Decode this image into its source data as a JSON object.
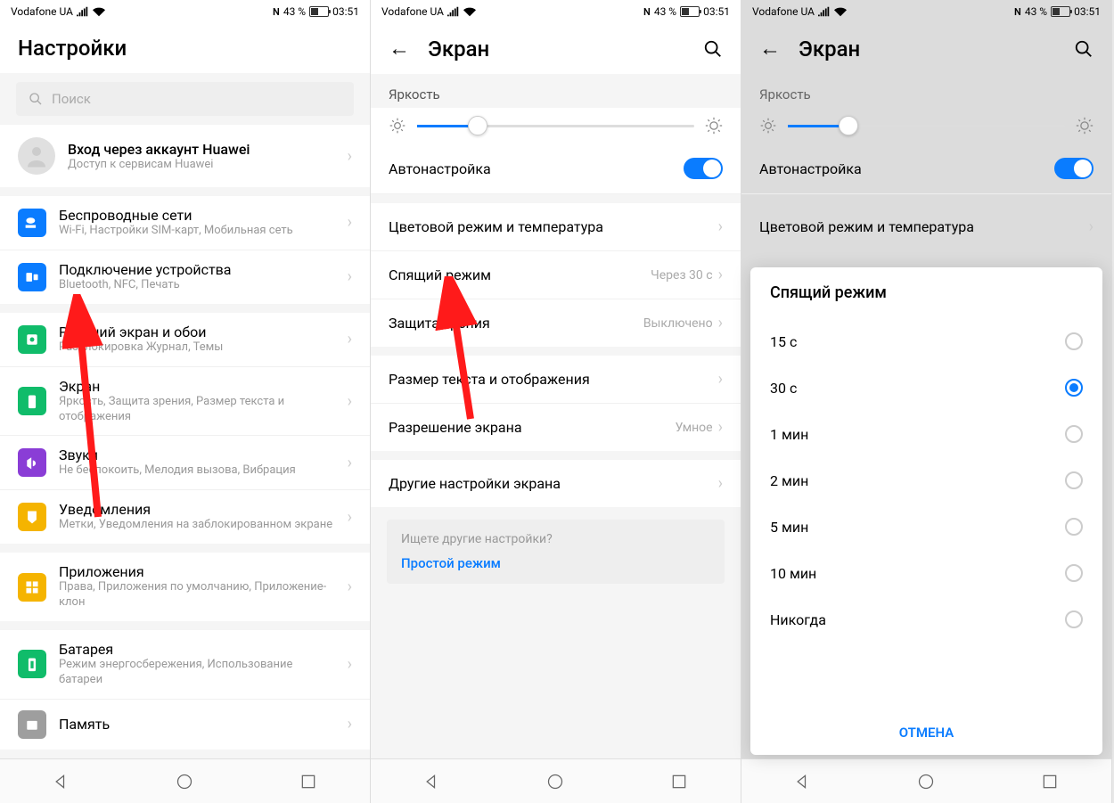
{
  "status": {
    "carrier": "Vodafone UA",
    "battery_pct": "43 %",
    "time": "03:51",
    "nfc": "N"
  },
  "screen1": {
    "title": "Настройки",
    "search_placeholder": "Поиск",
    "account": {
      "title": "Вход через аккаунт Huawei",
      "sub": "Доступ к сервисам Huawei"
    },
    "items": [
      {
        "title": "Беспроводные сети",
        "sub": "Wi-Fi, Настройки SIM-карт, Мобильная сеть",
        "color": "#0a7cff"
      },
      {
        "title": "Подключение устройства",
        "sub": "Bluetooth, NFC, Печать",
        "color": "#0a7cff"
      },
      {
        "title": "Рабочий экран и обои",
        "sub": "Разблокировка Журнал, Темы",
        "color": "#10bc6a"
      },
      {
        "title": "Экран",
        "sub": "Яркость, Защита зрения, Размер текста и отображения",
        "color": "#10bc6a"
      },
      {
        "title": "Звуки",
        "sub": "Не беспокоить, Мелодия вызова, Вибрация",
        "color": "#8a3dd6"
      },
      {
        "title": "Уведомления",
        "sub": "Метки, Уведомления на заблокированном экране",
        "color": "#f5b400"
      },
      {
        "title": "Приложения",
        "sub": "Права, Приложения по умолчанию, Приложение-клон",
        "color": "#f5b400"
      },
      {
        "title": "Батарея",
        "sub": "Режим энергосбережения, Использование батареи",
        "color": "#10bc6a"
      },
      {
        "title": "Память",
        "sub": "",
        "color": "#9e9e9e"
      }
    ]
  },
  "screen2": {
    "title": "Экран",
    "brightness_label": "Яркость",
    "auto_label": "Автонастройка",
    "rows": [
      {
        "title": "Цветовой режим и температура",
        "value": ""
      },
      {
        "title": "Спящий режим",
        "value": "Через 30 с"
      },
      {
        "title": "Защита зрения",
        "value": "Выключено"
      },
      {
        "title": "Размер текста и отображения",
        "value": ""
      },
      {
        "title": "Разрешение экрана",
        "value": "Умное"
      },
      {
        "title": "Другие настройки экрана",
        "value": ""
      }
    ],
    "tip_q": "Ищете другие настройки?",
    "tip_link": "Простой режим"
  },
  "screen3": {
    "title": "Экран",
    "brightness_label": "Яркость",
    "auto_label": "Автонастройка",
    "color_row": "Цветовой режим и температура",
    "dialog_title": "Спящий режим",
    "options": [
      "15 с",
      "30 с",
      "1 мин",
      "2 мин",
      "5 мин",
      "10 мин",
      "Никогда"
    ],
    "selected": "30 с",
    "cancel": "ОТМЕНА"
  }
}
